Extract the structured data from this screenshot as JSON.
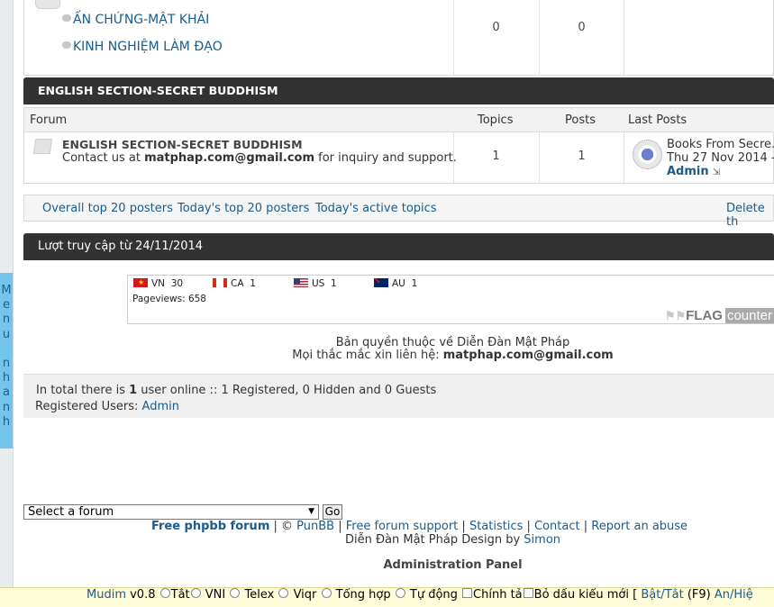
{
  "sidebar_menu": {
    "label": [
      "M",
      "e",
      "n",
      "u",
      "",
      "n",
      "h",
      "a",
      "n",
      "h"
    ]
  },
  "forums_top": {
    "rows": [
      {
        "name": "ẤN CHỨNG-MẬT KHẢI"
      },
      {
        "name": "KINH NGHIỆM LÀM ĐẠO"
      }
    ],
    "topics": "0",
    "posts": "0"
  },
  "english_section": {
    "category_title": "ENGLISH SECTION-SECRET BUDDHISM",
    "headers": {
      "forum": "Forum",
      "topics": "Topics",
      "posts": "Posts",
      "last_posts": "Last Posts"
    },
    "forum_title": "ENGLISH SECTION-SECRET BUDDHISM",
    "desc_prefix": "Contact us at ",
    "desc_email": "matphap.com@gmail.com",
    "desc_suffix": " for inquiry and support.",
    "topics": "1",
    "posts": "1",
    "last_post_title": "Books From Secre...",
    "last_post_date": "Thu 27 Nov 2014 -",
    "last_post_author": "Admin"
  },
  "topic_links": {
    "top20": "Overall top 20 posters",
    "today_top20": "Today's top 20 posters",
    "active": "Today's active topics",
    "delete": "Delete th"
  },
  "visits": {
    "title": "Lượt truy cập từ 24/11/2014",
    "flags": [
      {
        "code": "VN",
        "count": "30"
      },
      {
        "code": "CA",
        "count": "1"
      },
      {
        "code": "US",
        "count": "1"
      },
      {
        "code": "AU",
        "count": "1"
      }
    ],
    "pageviews": "Pageviews: 658",
    "logo_flag": "FLAG",
    "logo_counter": "counter"
  },
  "copyright": {
    "line1": "Bản quyền thuộc về Diễn Đàn Mật Pháp",
    "line2_prefix": "Mọi thắc mắc xin liên hệ: ",
    "line2_email": "matphap.com@gmail.com"
  },
  "online": {
    "prefix": "In total there is ",
    "count": "1",
    "suffix": " user online :: 1 Registered, 0 Hidden and 0 Guests",
    "registered_label": "Registered Users: ",
    "registered_user": "Admin"
  },
  "jump": {
    "select_value": "Select a forum",
    "go": "Go"
  },
  "footer": {
    "free_phpbb": "Free phpbb forum",
    "sep1": " | © ",
    "punbb": "PunBB",
    "support": "Free forum support",
    "statistics": "Statistics",
    "contact": "Contact",
    "report": "Report an abuse",
    "design_prefix": "Diễn Đàn Mật Pháp Design by ",
    "design_author": "Simon",
    "admin_panel": "Administration Panel"
  },
  "mudim": {
    "name": "Mudim",
    "version": " v0.8 ",
    "off": "Tắt",
    "vni": " VNI ",
    "telex": " Telex ",
    "viqr": " Viqr ",
    "tonghop": " Tổng hợp ",
    "tudong": " Tự động ",
    "chinhta": "Chính tả",
    "bodau": "Bỏ dấu kiểu mới [ ",
    "toggle": "Bật/Tắt",
    "f9": " (F9) ",
    "hide": "Ẩn/Hiệ"
  },
  "colors": {
    "accent": "#1a5b8c",
    "category_bar": "#323232",
    "menu_tab": "#74c5ee",
    "mudim_bg": "#fffcd9"
  }
}
